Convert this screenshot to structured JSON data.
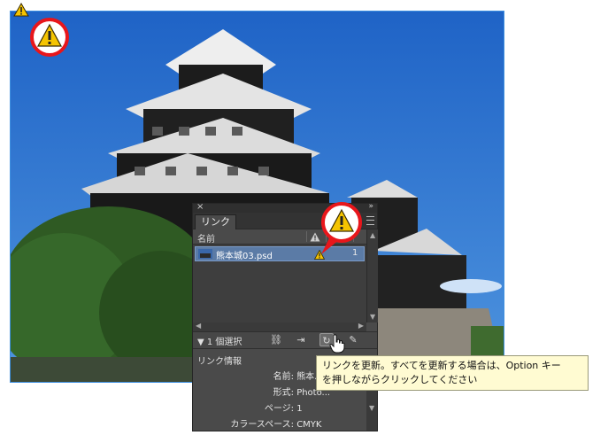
{
  "panel": {
    "close_glyph": "×",
    "collapse_glyph": "»",
    "tab_label": "リンク",
    "column_name": "名前",
    "link_file": "熊本城03.psd",
    "link_page": "1",
    "selection_label": "▼ 1 個選択",
    "info_label": "リンク情報",
    "info": [
      {
        "key": "名前:",
        "value": "熊本..."
      },
      {
        "key": "形式:",
        "value": "Photo..."
      },
      {
        "key": "ページ:",
        "value": "1"
      },
      {
        "key": "カラースペース:",
        "value": "CMYK"
      }
    ]
  },
  "tooltip": {
    "line1": "リンクを更新。すべてを更新する場合は、Option キー",
    "line2": "を押しながらクリックしてください"
  },
  "icons": [
    "warning-icon",
    "relink-icon",
    "goto-link-icon",
    "update-link-icon",
    "edit-original-icon",
    "hamburger-menu-icon"
  ],
  "colors": {
    "warning_fill": "#f5c400",
    "callout_ring": "#e8161b",
    "panel_bg": "#4a4a4a",
    "selected_row": "#5b7ba6",
    "frame_border": "#3d8fe0",
    "tooltip_bg": "#fffbd2"
  }
}
